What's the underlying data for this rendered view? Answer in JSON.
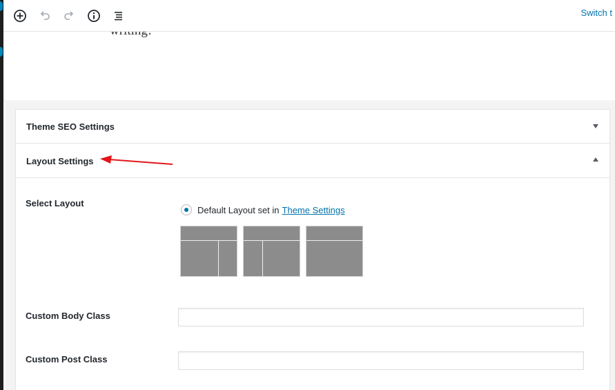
{
  "toolbar": {
    "icons": [
      "add-block-icon",
      "undo-icon",
      "redo-icon",
      "info-icon",
      "outline-icon"
    ],
    "switch_label": "Switch t"
  },
  "editor": {
    "writing_text": "writing!"
  },
  "panels": {
    "seo": {
      "title": "Theme SEO Settings"
    },
    "layout": {
      "title": "Layout Settings",
      "select_layout_label": "Select Layout",
      "radio_label": "Default Layout set in",
      "radio_link": "Theme Settings",
      "custom_body_class_label": "Custom Body Class",
      "custom_body_class_value": "",
      "custom_post_class_label": "Custom Post Class",
      "custom_post_class_value": ""
    }
  },
  "colors": {
    "accent": "#0073aa",
    "annotation_arrow": "#e3151a",
    "layout_thumb": "#8c8c8c"
  }
}
